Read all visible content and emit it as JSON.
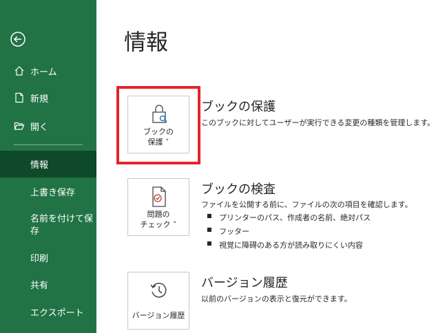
{
  "sidebar": {
    "items": [
      {
        "label": "ホーム"
      },
      {
        "label": "新規"
      },
      {
        "label": "開く"
      },
      {
        "label": "情報"
      },
      {
        "label": "上書き保存"
      },
      {
        "label": "名前を付けて保存"
      },
      {
        "label": "印刷"
      },
      {
        "label": "共有"
      },
      {
        "label": "エクスポート"
      }
    ]
  },
  "main": {
    "title": "情報",
    "sections": [
      {
        "tile_line1": "ブックの",
        "tile_line2": "保護 ˅",
        "heading": "ブックの保護",
        "description": "このブックに対してユーザーが実行できる変更の種類を管理します。"
      },
      {
        "tile_line1": "問題の",
        "tile_line2": "チェック ˅",
        "heading": "ブックの検査",
        "description": "ファイルを公開する前に、ファイルの次の項目を確認します。",
        "bullets": [
          "プリンターのパス、作成者の名前、絶対パス",
          "フッター",
          "視覚に障碍のある方が読み取りにくい内容"
        ]
      },
      {
        "tile_line1": "バージョン履歴",
        "heading": "バージョン履歴",
        "description": "以前のバージョンの表示と復元ができます。"
      }
    ]
  },
  "colors": {
    "sidebar": "#217346",
    "sidebar_active": "#0e4a2a",
    "highlight": "#e3242b"
  }
}
